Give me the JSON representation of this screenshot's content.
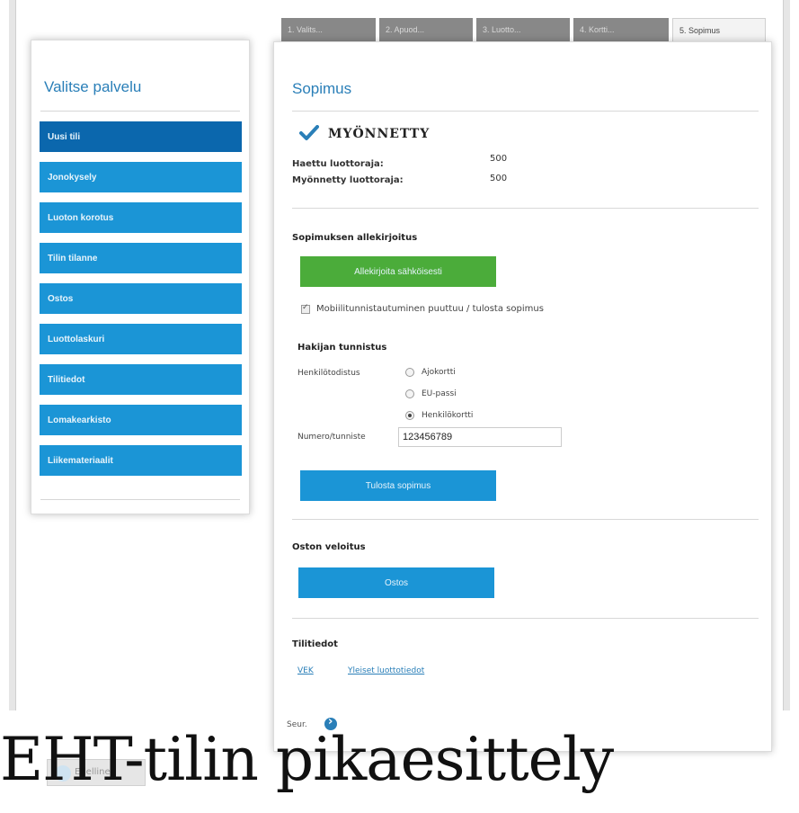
{
  "sidebar": {
    "title": "Valitse palvelu",
    "items": [
      {
        "label": "Uusi tili",
        "active": true
      },
      {
        "label": "Jonokysely",
        "active": false
      },
      {
        "label": "Luoton korotus",
        "active": false
      },
      {
        "label": "Tilin tilanne",
        "active": false
      },
      {
        "label": "Ostos",
        "active": false
      },
      {
        "label": "Luottolaskuri",
        "active": false
      },
      {
        "label": "Tilitiedot",
        "active": false
      },
      {
        "label": "Lomakearkisto",
        "active": false
      },
      {
        "label": "Liikemateriaalit",
        "active": false
      }
    ]
  },
  "tabs": [
    {
      "label": "1. Valits...",
      "active": false
    },
    {
      "label": "2. Apuod...",
      "active": false
    },
    {
      "label": "3. Luotto...",
      "active": false
    },
    {
      "label": "4. Kortti...",
      "active": false
    },
    {
      "label": "5. Sopimus",
      "active": true
    }
  ],
  "main": {
    "title": "Sopimus",
    "status": "Myönnetty",
    "applied_limit_label": "Haettu luottoraja:",
    "applied_limit_value": "500",
    "granted_limit_label": "Myönnetty luottoraja:",
    "granted_limit_value": "500",
    "sign_section": "Sopimuksen allekirjoitus",
    "sign_button": "Allekirjoita sähköisesti",
    "mobile_checkbox_label": "Mobiilitunnistautuminen puuttuu / tulosta sopimus",
    "id_section": "Hakijan tunnistus",
    "id_doc_label": "Henkilötodistus",
    "id_options": [
      "Ajokortti",
      "EU-passi",
      "Henkilökortti"
    ],
    "id_selected": "Henkilökortti",
    "id_number_label": "Numero/tunniste",
    "id_number_value": "123456789",
    "print_button": "Tulosta sopimus",
    "purchase_section": "Oston veloitus",
    "purchase_button": "Ostos",
    "account_section": "Tilitiedot",
    "links": [
      "VEK",
      "Yleiset luottotiedot"
    ],
    "next_label": "Seur."
  },
  "back_label": "Edellinen",
  "caption": "EHT-tilin pikaesittely"
}
